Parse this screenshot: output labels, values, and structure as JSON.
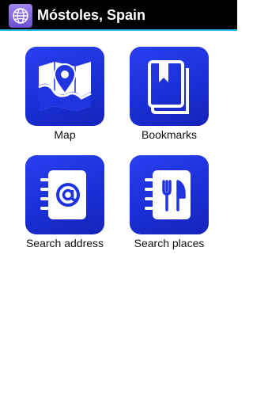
{
  "header": {
    "title": "Móstoles, Spain",
    "app_icon": "globe-icon"
  },
  "tiles": [
    {
      "label": "Map",
      "icon": "map-pin-icon"
    },
    {
      "label": "Bookmarks",
      "icon": "bookmark-book-icon"
    },
    {
      "label": "Search address",
      "icon": "address-book-at-icon"
    },
    {
      "label": "Search places",
      "icon": "restaurant-notebook-icon"
    }
  ],
  "colors": {
    "accent": "#33b5e5",
    "tile_blue": "#1f34e0",
    "app_icon_purple": "#7b5fe0"
  }
}
